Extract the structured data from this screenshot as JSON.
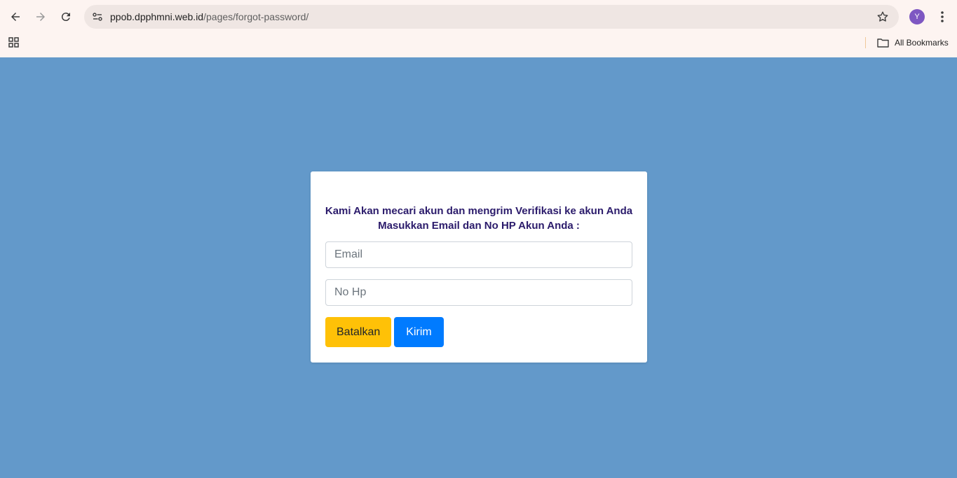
{
  "browser": {
    "url_host": "ppob.dpphmni.web.id",
    "url_path": "/pages/forgot-password/",
    "profile_initial": "Y",
    "all_bookmarks_label": "All Bookmarks"
  },
  "form": {
    "title": "Kami Akan mecari akun dan mengrim Verifikasi ke akun Anda Masukkan Email dan No HP Akun Anda :",
    "email_placeholder": "Email",
    "phone_placeholder": "No Hp",
    "cancel_label": "Batalkan",
    "submit_label": "Kirim"
  },
  "colors": {
    "page_background": "#6399ca",
    "cancel_button": "#ffc107",
    "submit_button": "#007bff",
    "title_text": "#2b1b6b"
  },
  "icons": [
    "back-arrow-icon",
    "forward-arrow-icon",
    "reload-icon",
    "site-info-icon",
    "bookmark-star-icon",
    "kebab-menu-icon",
    "apps-grid-icon",
    "folder-icon"
  ]
}
